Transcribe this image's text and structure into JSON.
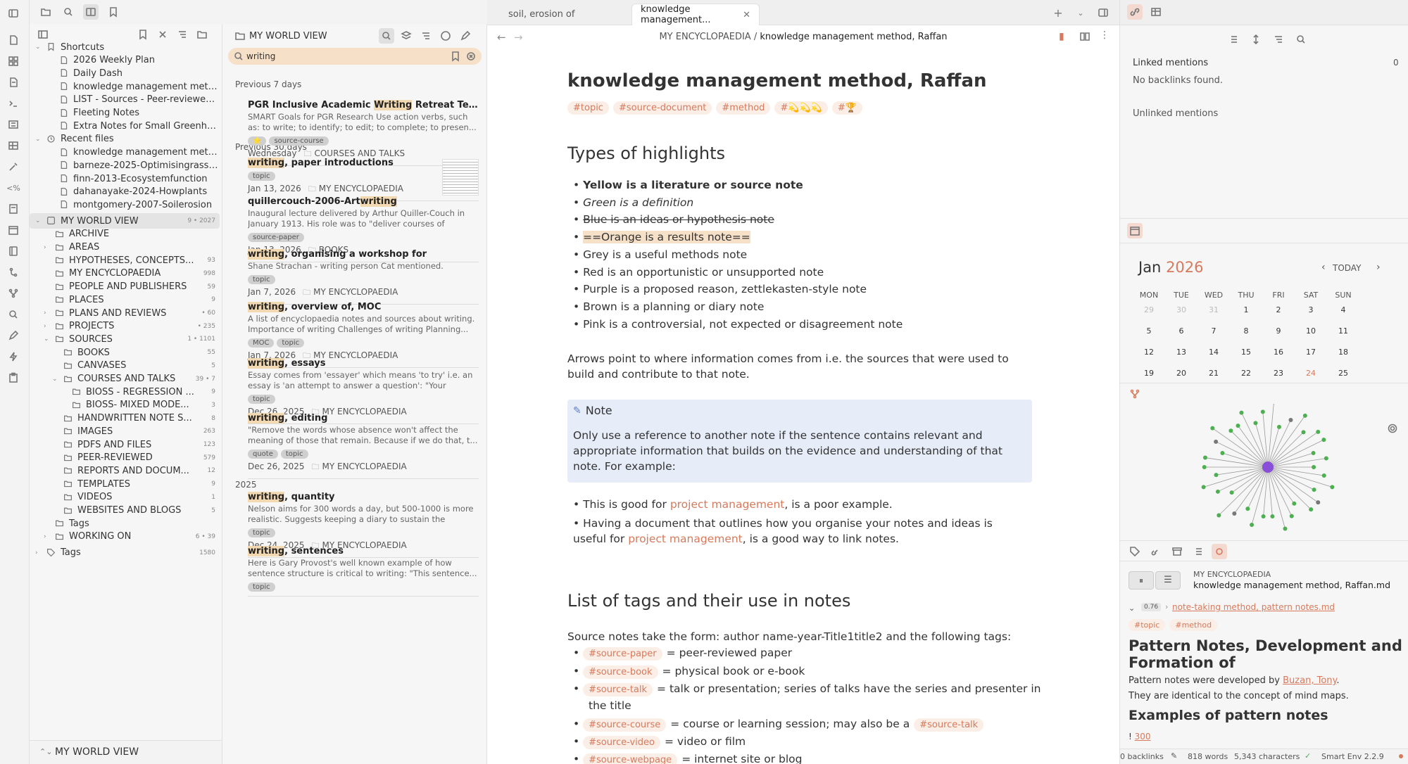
{
  "explorer": {
    "shortcuts_label": "Shortcuts",
    "shortcuts": [
      "2026 Weekly Plan",
      "Daily Dash",
      "knowledge management method...",
      "LIST - Sources - Peer-reviewed a...",
      "Fleeting Notes",
      "Extra Notes for Small Greenhou..."
    ],
    "recent_label": "Recent files",
    "recent": [
      "knowledge management method...",
      "barneze-2025-Optimisingrassleg...",
      "finn-2013-Ecosystemfunction",
      "dahanayake-2024-Howplants",
      "montgomery-2007-Soilerosion"
    ],
    "vault": {
      "name": "MY WORLD VIEW",
      "count": "9 • 2027"
    },
    "folders": [
      {
        "name": "ARCHIVE",
        "count": "",
        "indent": 1,
        "caret": false
      },
      {
        "name": "AREAS",
        "count": "",
        "indent": 1,
        "caret": true
      },
      {
        "name": "HYPOTHESES, CONCEPTS...",
        "count": "93",
        "indent": 1,
        "caret": false
      },
      {
        "name": "MY ENCYCLOPAEDIA",
        "count": "998",
        "indent": 1,
        "caret": false
      },
      {
        "name": "PEOPLE AND PUBLISHERS",
        "count": "59",
        "indent": 1,
        "caret": false
      },
      {
        "name": "PLACES",
        "count": "9",
        "indent": 1,
        "caret": false
      },
      {
        "name": "PLANS AND REVIEWS",
        "count": "• 60",
        "indent": 1,
        "caret": true
      },
      {
        "name": "PROJECTS",
        "count": "• 235",
        "indent": 1,
        "caret": true
      },
      {
        "name": "SOURCES",
        "count": "1 • 1101",
        "indent": 1,
        "caret": true
      },
      {
        "name": "BOOKS",
        "count": "55",
        "indent": 2,
        "caret": false
      },
      {
        "name": "CANVASES",
        "count": "5",
        "indent": 2,
        "caret": false
      },
      {
        "name": "COURSES AND TALKS",
        "count": "39 • 7",
        "indent": 2,
        "caret": true
      },
      {
        "name": "BIOSS - REGRESSION ...",
        "count": "9",
        "indent": 3,
        "caret": false
      },
      {
        "name": "BIOSS- MIXED MODE...",
        "count": "3",
        "indent": 3,
        "caret": false
      },
      {
        "name": "HANDWRITTEN NOTE S...",
        "count": "8",
        "indent": 2,
        "caret": false
      },
      {
        "name": "IMAGES",
        "count": "263",
        "indent": 2,
        "caret": false
      },
      {
        "name": "PDFS AND FILES",
        "count": "123",
        "indent": 2,
        "caret": false
      },
      {
        "name": "PEER-REVIEWED",
        "count": "579",
        "indent": 2,
        "caret": false
      },
      {
        "name": "REPORTS AND DOCUM...",
        "count": "12",
        "indent": 2,
        "caret": false
      },
      {
        "name": "TEMPLATES",
        "count": "9",
        "indent": 2,
        "caret": false
      },
      {
        "name": "VIDEOS",
        "count": "1",
        "indent": 2,
        "caret": false
      },
      {
        "name": "WEBSITES AND BLOGS",
        "count": "5",
        "indent": 2,
        "caret": false
      },
      {
        "name": "Tags",
        "count": "",
        "indent": 1,
        "caret": false
      },
      {
        "name": "WORKING ON",
        "count": "6 • 39",
        "indent": 1,
        "caret": true
      }
    ],
    "tags_label": "Tags",
    "tags_count": "1580",
    "footer_vault": "MY WORLD VIEW"
  },
  "search": {
    "header": "MY WORLD VIEW",
    "query": "writing",
    "sections": [
      "Previous 7 days",
      "Previous 30 days",
      "2025"
    ],
    "results": [
      {
        "title_pre": "PGR Inclusive Academic ",
        "title_hl": "Writing",
        "title_post": " Retreat Template",
        "snippet": "SMART Goals for PGR Research Use action verbs, such as: to write; to identify; to edit; to complete; to presen...",
        "pills": [
          "⭐",
          "source-course"
        ],
        "date": "Wednesday",
        "folder": "COURSES AND TALKS"
      },
      {
        "title_pre": "",
        "title_hl": "writing",
        "title_post": ", paper introductions",
        "snippet": "",
        "pills": [
          "topic"
        ],
        "date": "Jan 13, 2026",
        "folder": "MY ENCYCLOPAEDIA"
      },
      {
        "title_pre": "quillercouch-2006-Art",
        "title_hl": "writing",
        "title_post": "",
        "snippet": "Inaugural lecture delivered by Arthur Quiller-Couch in January 1913. His role was to \"deliver courses of lecture...",
        "pills": [
          "source-paper"
        ],
        "date": "Jan 13, 2026",
        "folder": "BOOKS"
      },
      {
        "title_pre": "",
        "title_hl": "writing",
        "title_post": ", organising a workshop for",
        "snippet": "Shane Strachan - writing person Cat mentioned.",
        "pills": [
          "topic"
        ],
        "date": "Jan 7, 2026",
        "folder": "MY ENCYCLOPAEDIA"
      },
      {
        "title_pre": "",
        "title_hl": "writing",
        "title_post": ", overview of, MOC",
        "snippet": "A list of encyclopaedia notes and sources about writing. Importance of writing Challenges of writing Planning...",
        "pills": [
          "MOC",
          "topic"
        ],
        "date": "Jan 7, 2026",
        "folder": "MY ENCYCLOPAEDIA"
      },
      {
        "title_pre": "",
        "title_hl": "writing",
        "title_post": ", essays",
        "snippet": "Essay comes from 'essayer' which means 'to try' i.e. an essay is 'an attempt to answer a question': \"Your attem...",
        "pills": [
          "topic"
        ],
        "date": "Dec 26, 2025",
        "folder": "MY ENCYCLOPAEDIA"
      },
      {
        "title_pre": "",
        "title_hl": "writing",
        "title_post": ", editing",
        "snippet": "\"Remove the words whose absence won't affect the meaning of those that remain. Because if we do that, t...",
        "pills": [
          "quote",
          "topic"
        ],
        "date": "Dec 26, 2025",
        "folder": "MY ENCYCLOPAEDIA"
      },
      {
        "title_pre": "",
        "title_hl": "writing",
        "title_post": ", quantity",
        "snippet": "Nelson aims for 300 words a day, but 500-1000 is more realistic. Suggests keeping a diary to sustain the writing...",
        "pills": [
          "topic"
        ],
        "date": "Dec 24, 2025",
        "folder": "MY ENCYCLOPAEDIA"
      },
      {
        "title_pre": "",
        "title_hl": "writing",
        "title_post": ", sentences",
        "snippet": "Here is Gary Provost's well known example of how sentence structure is critical to writing: \"This sentence...",
        "pills": [
          "topic"
        ],
        "date": "",
        "folder": ""
      }
    ]
  },
  "tabs": [
    {
      "label": "soil, erosion of"
    },
    {
      "label": "knowledge management..."
    }
  ],
  "editor": {
    "breadcrumb_folder": "MY ENCYCLOPAEDIA",
    "breadcrumb_sep": "/",
    "breadcrumb_note": "knowledge management method, Raffan",
    "title": "knowledge management method, Raffan",
    "tags": [
      "#topic",
      "#source-document",
      "#method",
      "#💫💫💫",
      "#🏆"
    ],
    "h_highlights": "Types of highlights",
    "highlights": [
      {
        "text": "Yellow is a literature or source note",
        "style": "bold"
      },
      {
        "text": "Green is a definition",
        "style": "italic"
      },
      {
        "text": "Blue is an ideas or hypothesis note",
        "style": "strike"
      },
      {
        "text": "==Orange is a results note==",
        "style": "mark"
      },
      {
        "text": "Grey is a useful methods note",
        "style": "normal"
      },
      {
        "text": "Red is an opportunistic or unsupported note",
        "style": "normal"
      },
      {
        "text": "Purple is a proposed reason, zettlekasten-style note",
        "style": "normal"
      },
      {
        "text": "Brown is a planning or diary note",
        "style": "normal"
      },
      {
        "text": "Pink is a controversial, not expected or disagreement note",
        "style": "normal"
      }
    ],
    "arrows_para": "Arrows point to where information comes from i.e. the sources that were used to build and contribute to that note.",
    "callout_title": "Note",
    "callout_body": "Only use a reference to another note if the sentence contains relevant and appropriate information that builds on the evidence and understanding of that note. For example:",
    "ex1_pre": "This is good for ",
    "ex1_link": "project management",
    "ex1_post": ", is a poor example.",
    "ex2_pre": "Having a document that outlines how you organise your notes and ideas is useful for ",
    "ex2_link": "project management",
    "ex2_post": ", is a good way to link notes.",
    "h_tags": "List of tags and their use in notes",
    "tags_intro": "Source notes take the form: author name-year-Title1title2 and the following tags:",
    "tag_rows": [
      {
        "tag": "#source-paper",
        "desc": "= peer-reviewed paper"
      },
      {
        "tag": "#source-book",
        "desc": "= physical book or e-book"
      },
      {
        "tag": "#source-talk",
        "desc": "= talk or presentation; series of talks have the series and presenter in"
      },
      {
        "tag": "#source-course",
        "desc": "= course or learning session; may also be a"
      },
      {
        "tag": "#source-video",
        "desc": "= video or film"
      },
      {
        "tag": "#source-webpage",
        "desc": "= internet site or blog"
      }
    ],
    "talk_cont": "the title",
    "course_extra_tag": "#source-talk"
  },
  "right": {
    "linked_label": "Linked mentions",
    "linked_count": "0",
    "no_backlinks": "No backlinks found.",
    "unlinked_label": "Unlinked mentions",
    "cal_month": "Jan",
    "cal_year": "2026",
    "cal_today": "TODAY",
    "cal_days": [
      "MON",
      "TUE",
      "WED",
      "THU",
      "FRI",
      "SAT",
      "SUN"
    ],
    "cal_weeks": [
      [
        "29",
        "30",
        "31",
        "1",
        "2",
        "3",
        "4"
      ],
      [
        "5",
        "6",
        "7",
        "8",
        "9",
        "10",
        "11"
      ],
      [
        "12",
        "13",
        "14",
        "15",
        "16",
        "17",
        "18"
      ],
      [
        "19",
        "20",
        "21",
        "22",
        "23",
        "24",
        "25"
      ]
    ],
    "sc_folder": "MY ENCYCLOPAEDIA",
    "sc_file": "knowledge management method, Raffan.md",
    "sc_score": "0.76",
    "sc_link": "note-taking method, pattern notes.md",
    "sc_tags": [
      "#topic",
      "#method"
    ],
    "sc_h1": "Pattern Notes, Development and Formation of",
    "sc_p1_pre": "Pattern notes were developed by ",
    "sc_p1_link": "Buzan, Tony",
    "sc_p1_post": ".",
    "sc_p2": "They are identical to the concept of mind maps.",
    "sc_h2": "Examples of pattern notes",
    "sc_bang": "!",
    "sc_num": "300"
  },
  "status": {
    "backlinks": "0 backlinks",
    "words": "818 words",
    "chars": "5,343 characters",
    "smart": "Smart Env 2.2.9"
  },
  "colors": {
    "accent": "#d77a5c",
    "selected": "#e4e4e4",
    "callout": "#e6ecf8",
    "graph_node": "#4caf50",
    "graph_center": "#8a4fd8"
  }
}
